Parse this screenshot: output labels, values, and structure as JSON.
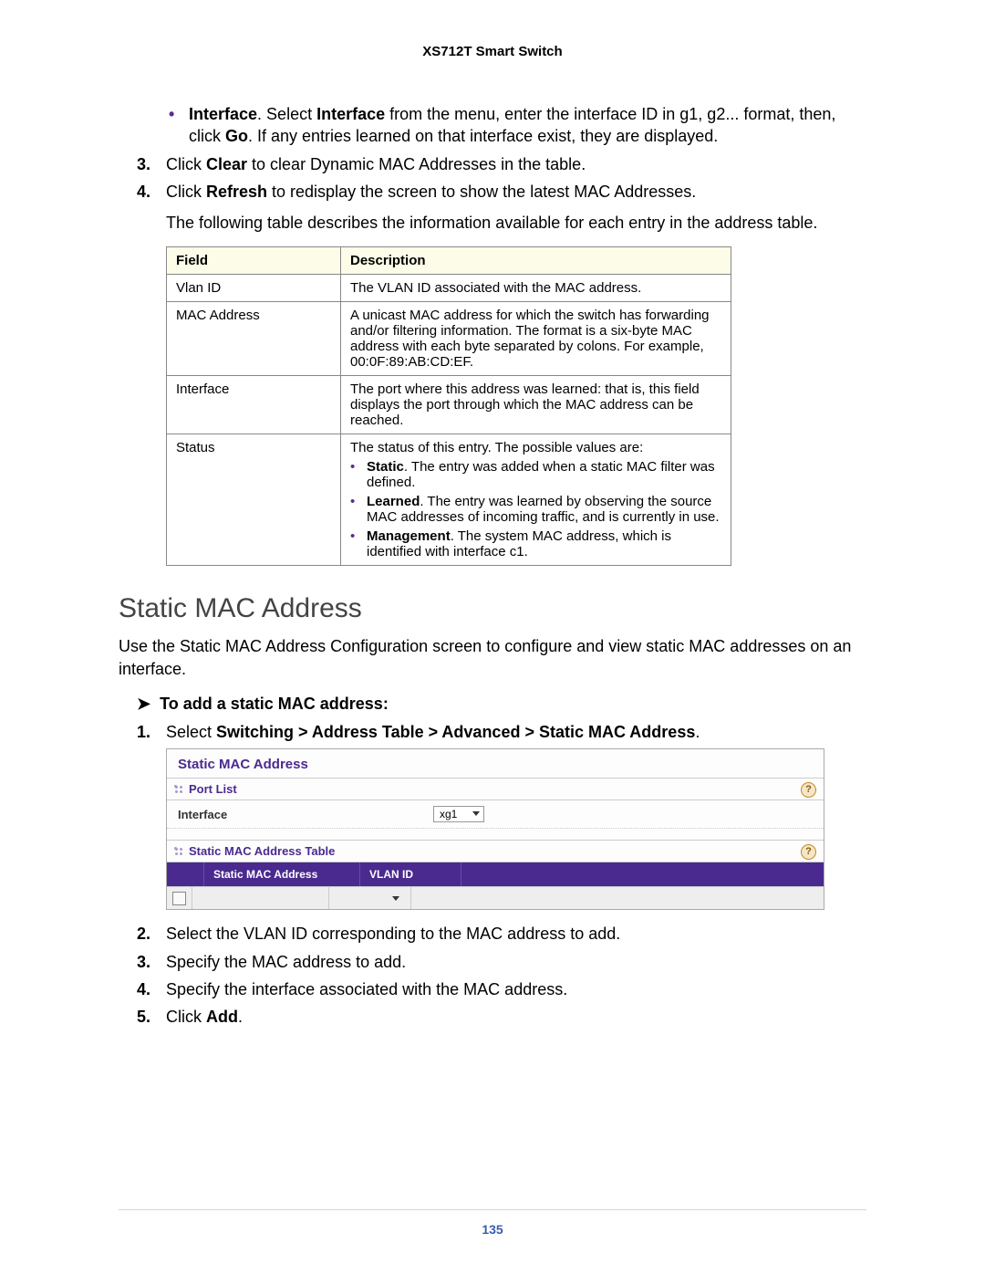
{
  "header": {
    "title": "XS712T Smart Switch"
  },
  "intro_bullet": {
    "label_bold": "Interface",
    "text_1": ". Select ",
    "bold_2": "Interface",
    "text_2": " from the menu, enter the interface ID in g1, g2... format, then, click ",
    "bold_3": "Go",
    "text_3": ". If any entries learned on that interface exist, they are displayed."
  },
  "steps_top": [
    {
      "num": "3.",
      "pre": "Click ",
      "bold": "Clear",
      "post": " to clear Dynamic MAC Addresses in the table."
    },
    {
      "num": "4.",
      "pre": "Click ",
      "bold": "Refresh",
      "post": " to redisplay the screen to show the latest MAC Addresses."
    }
  ],
  "table_intro": "The following table describes the information available for each entry in the address table.",
  "field_table": {
    "headers": {
      "field": "Field",
      "description": "Description"
    },
    "rows": [
      {
        "field": "Vlan ID",
        "desc": "The VLAN ID associated with the MAC address."
      },
      {
        "field": "MAC Address",
        "desc": "A unicast MAC address for which the switch has forwarding and/or filtering information. The format is a six-byte MAC address with each byte separated by colons. For example, 00:0F:89:AB:CD:EF."
      },
      {
        "field": "Interface",
        "desc": "The port where this address was learned: that is, this field displays the port through which the MAC address can be reached."
      },
      {
        "field": "Status",
        "desc_intro": "The status of this entry. The possible values are:",
        "items": [
          {
            "bold": "Static",
            "text": ". The entry was added when a static MAC filter was defined."
          },
          {
            "bold": "Learned",
            "text": ". The entry was learned by observing the source MAC addresses of incoming traffic, and is currently in use."
          },
          {
            "bold": "Management",
            "text": ". The system MAC address, which is identified with interface c1."
          }
        ]
      }
    ]
  },
  "section_heading": "Static MAC Address",
  "section_para": "Use the Static MAC Address Configuration screen to configure and view static MAC addresses on an interface.",
  "task_heading": "To add a static MAC address:",
  "task_step1": {
    "num": "1.",
    "pre": "Select ",
    "path": "Switching > Address Table > Advanced > Static MAC Address",
    "post": "."
  },
  "ui": {
    "title": "Static MAC Address",
    "port_list": "Port List",
    "interface_label": "Interface",
    "interface_value": "xg1",
    "table_title": "Static MAC Address Table",
    "col_mac": "Static MAC Address",
    "col_vlan": "VLAN ID",
    "help_symbol": "?"
  },
  "steps_bottom": [
    {
      "num": "2.",
      "text": "Select the VLAN ID corresponding to the MAC address to add."
    },
    {
      "num": "3.",
      "text": "Specify the MAC address to add."
    },
    {
      "num": "4.",
      "text": "Specify the interface associated with the MAC address."
    },
    {
      "num": "5.",
      "pre": "Click ",
      "bold": "Add",
      "post": "."
    }
  ],
  "page_number": "135"
}
